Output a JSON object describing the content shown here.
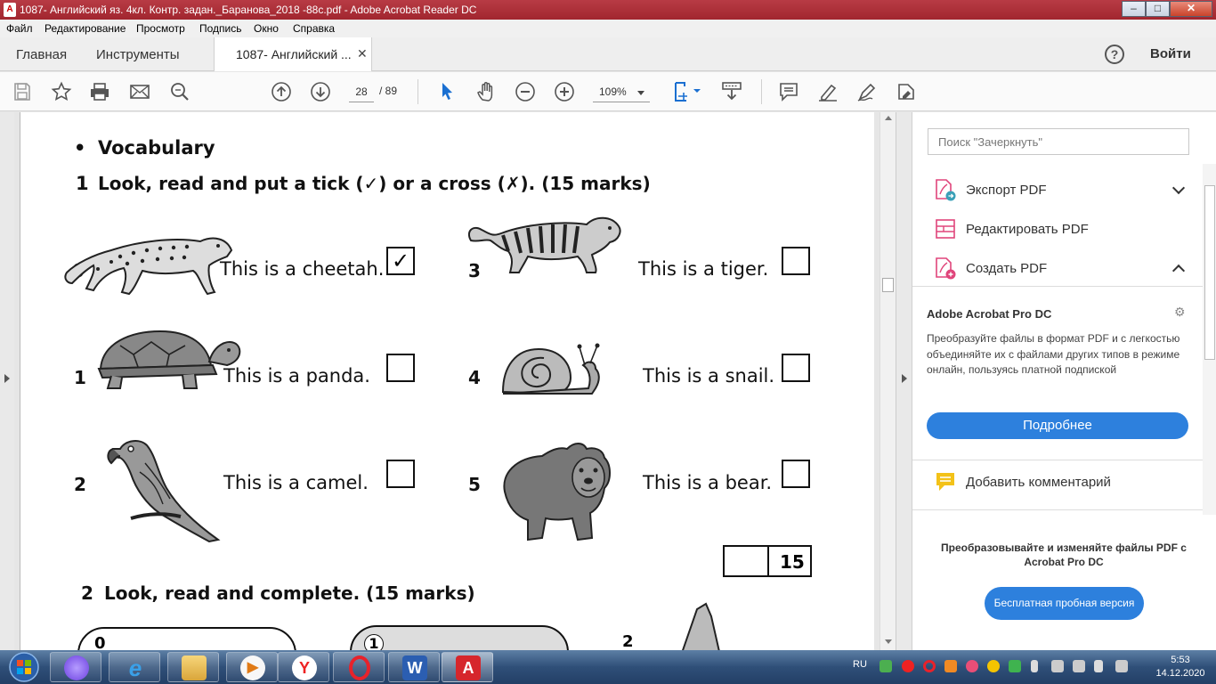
{
  "window": {
    "title": "1087- Английский яз. 4кл. Контр. задан._Баранова_2018 -88с.pdf - Adobe Acrobat Reader DC",
    "minimize": "–",
    "maximize": "□",
    "close": "✕"
  },
  "menu": [
    "Файл",
    "Редактирование",
    "Просмотр",
    "Подпись",
    "Окно",
    "Справка"
  ],
  "tabs": {
    "home": "Главная",
    "tools": "Инструменты",
    "document": "1087- Английский ...",
    "close": "✕",
    "help": "?",
    "login": "Войти"
  },
  "toolbar": {
    "page_current": "28",
    "page_total": "/ 89",
    "zoom": "109%"
  },
  "worksheet": {
    "section_bullet": "•",
    "section_title": "Vocabulary",
    "task1_number": "1",
    "task1_title": "Look, read and put a tick (✓) or a cross (✗). (15 marks)",
    "items": [
      {
        "num": "0",
        "sentence": "This is a cheetah.",
        "mark": "✓",
        "animal": "cheetah"
      },
      {
        "num": "1",
        "sentence": "This is a panda.",
        "mark": "",
        "animal": "tortoise"
      },
      {
        "num": "2",
        "sentence": "This is a camel.",
        "mark": "",
        "animal": "parrot"
      },
      {
        "num": "3",
        "sentence": "This is a tiger.",
        "mark": "",
        "animal": "tiger"
      },
      {
        "num": "4",
        "sentence": "This is a snail.",
        "mark": "",
        "animal": "snail"
      },
      {
        "num": "5",
        "sentence": "This is a bear.",
        "mark": "",
        "animal": "bear"
      }
    ],
    "score": "15",
    "task2_number": "2",
    "task2_title": "Look, read and complete. (15 marks)",
    "task2_labels": [
      "0",
      "1",
      "2"
    ]
  },
  "right_panel": {
    "search_placeholder": "Поиск \"Зачеркнуть\"",
    "tools": [
      {
        "label": "Экспорт PDF",
        "icon": "export-pdf-icon"
      },
      {
        "label": "Редактировать PDF",
        "icon": "edit-pdf-icon"
      },
      {
        "label": "Создать PDF",
        "icon": "create-pdf-icon"
      }
    ],
    "promo_title": "Adobe Acrobat Pro DC",
    "promo_text": "Преобразуйте файлы в формат PDF и с легкостью объединяйте их с файлами других типов в режиме онлайн, пользуясь платной подпиской",
    "more_button": "Подробнее",
    "add_comment": "Добавить комментарий",
    "convert_text": "Преобразовывайте и изменяйте файлы PDF с Acrobat Pro DC",
    "trial_button": "Бесплатная пробная версия"
  },
  "taskbar": {
    "language": "RU",
    "time": "5:53",
    "date": "14.12.2020"
  },
  "colors": {
    "title_bar": "#a8303a",
    "accent_blue": "#2d80dd",
    "taskbar": "#2f4f78"
  }
}
